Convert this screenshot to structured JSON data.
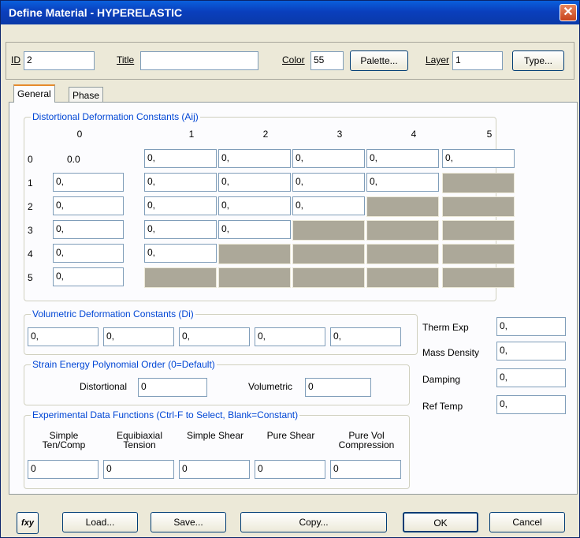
{
  "window": {
    "title": "Define Material - HYPERELASTIC",
    "close_glyph": "✕"
  },
  "top": {
    "id_label": "ID",
    "id_value": "2",
    "title_label": "Title",
    "title_value": "",
    "color_label": "Color",
    "color_value": "55",
    "palette_label": "Palette...",
    "layer_label": "Layer",
    "layer_value": "1",
    "type_label": "Type..."
  },
  "tabs": [
    {
      "label": "General"
    },
    {
      "label": "Phase"
    }
  ],
  "distortional": {
    "title": "Distortional Deformation Constants (Aij)",
    "col_headers": [
      "0",
      "1",
      "2",
      "3",
      "4",
      "5"
    ],
    "row_headers": [
      "0",
      "1",
      "2",
      "3",
      "4",
      "5"
    ],
    "a00": "0.0",
    "rows": [
      [
        "0.0",
        "0,",
        "0,",
        "0,",
        "0,",
        "0,"
      ],
      [
        "0,",
        "0,",
        "0,",
        "0,",
        "0,",
        ""
      ],
      [
        "0,",
        "0,",
        "0,",
        "0,",
        "",
        ""
      ],
      [
        "0,",
        "0,",
        "0,",
        "",
        "",
        ""
      ],
      [
        "0,",
        "0,",
        "",
        "",
        "",
        ""
      ],
      [
        "0,",
        "",
        "",
        "",
        "",
        ""
      ]
    ]
  },
  "volumetric": {
    "title": "Volumetric Deformation Constants (Di)",
    "values": [
      "0,",
      "0,",
      "0,",
      "0,",
      "0,"
    ]
  },
  "strain_energy": {
    "title": "Strain Energy Polynomial Order (0=Default)",
    "distortional_label": "Distortional",
    "distortional_value": "0",
    "volumetric_label": "Volumetric",
    "volumetric_value": "0"
  },
  "experimental": {
    "title": "Experimental Data Functions (Ctrl-F to Select, Blank=Constant)",
    "headers": [
      [
        "Simple",
        "Ten/Comp"
      ],
      [
        "Equibiaxial",
        "Tension"
      ],
      [
        "Simple Shear",
        ""
      ],
      [
        "Pure Shear",
        ""
      ],
      [
        "Pure Vol",
        "Compression"
      ]
    ],
    "values": [
      "0",
      "0",
      "0",
      "0",
      "0"
    ]
  },
  "properties": {
    "therm_exp_label": "Therm Exp",
    "therm_exp_value": "0,",
    "mass_density_label": "Mass Density",
    "mass_density_value": "0,",
    "damping_label": "Damping",
    "damping_value": "0,",
    "ref_temp_label": "Ref Temp",
    "ref_temp_value": "0,"
  },
  "buttons": {
    "fxy_label": "fxy",
    "load_label": "Load...",
    "save_label": "Save...",
    "copy_label": "Copy...",
    "ok_label": "OK",
    "cancel_label": "Cancel"
  }
}
